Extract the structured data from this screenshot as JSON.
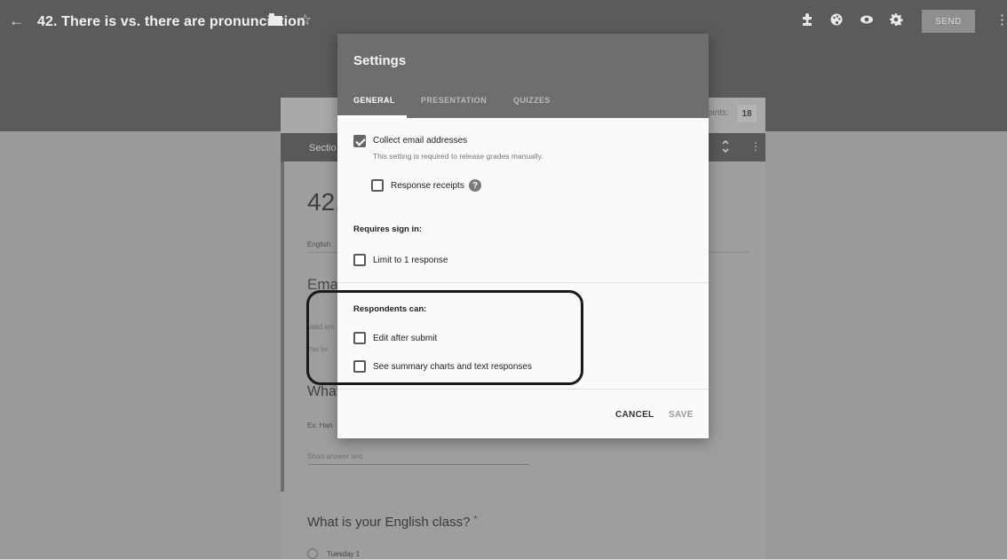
{
  "app": {
    "title": "42. There is vs. there are pronunciation",
    "send_label": "SEND"
  },
  "icons": {
    "back": "arrow-left-icon",
    "folder": "folder-icon",
    "star": "star-icon",
    "addons": "puzzle-icon",
    "theme": "palette-icon",
    "preview": "eye-icon",
    "settings": "gear-icon",
    "more": "more-vert-icon"
  },
  "form": {
    "points_label": "oints:",
    "points_value": "18",
    "section_label": "Sectio",
    "title_fragment": "42.",
    "description_fragment": "English",
    "email_fragment": "Emai",
    "valid_fragment": "Valid em",
    "this_form_fragment": "This for",
    "what_fragment": "What",
    "ex_fragment": "Ex: Han",
    "short_answer": "Short answer text",
    "class_question": "What is your English class?",
    "required_mark": "*",
    "option_1": "Tuesday 1"
  },
  "dialog": {
    "title": "Settings",
    "tabs": [
      {
        "label": "GENERAL",
        "active": true
      },
      {
        "label": "PRESENTATION",
        "active": false
      },
      {
        "label": "QUIZZES",
        "active": false
      }
    ],
    "collect_email": {
      "label": "Collect email addresses",
      "checked": true
    },
    "collect_email_note": "This setting is required to release grades manually.",
    "response_receipts": {
      "label": "Response receipts",
      "checked": false
    },
    "requires_sign_in": "Requires sign in:",
    "limit_one": {
      "label": "Limit to 1 response",
      "checked": false
    },
    "respondents_can": "Respondents can:",
    "edit_after": {
      "label": "Edit after submit",
      "checked": false
    },
    "see_summary": {
      "label": "See summary charts and text responses",
      "checked": false
    },
    "cancel_label": "CANCEL",
    "save_label": "SAVE"
  }
}
